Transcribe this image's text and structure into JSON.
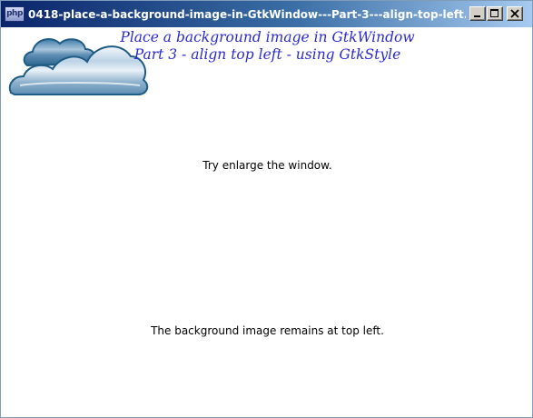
{
  "window": {
    "title": "0418-place-a-background-image-in-GtkWindow---Part-3---align-top-left...",
    "app_icon_text": "php",
    "controls": {
      "minimize_icon": "minimize-icon",
      "maximize_icon": "maximize-icon",
      "close_icon": "close-icon"
    }
  },
  "content": {
    "heading_line1": "Place a background image in GtkWindow",
    "heading_line2": "Part 3 - align top left - using GtkStyle",
    "label_enlarge": "Try enlarge the window.",
    "label_remains": "The background image remains at top left."
  },
  "background_image": {
    "icon": "clouds-icon",
    "colors": {
      "outline": "#1e5c85",
      "fill_light": "#e8f1f8",
      "fill_dark": "#6f9cbd"
    }
  },
  "colors": {
    "title_bar_start": "#0a246a",
    "title_bar_end": "#a6caf0",
    "heading_text": "#2a2acf"
  }
}
